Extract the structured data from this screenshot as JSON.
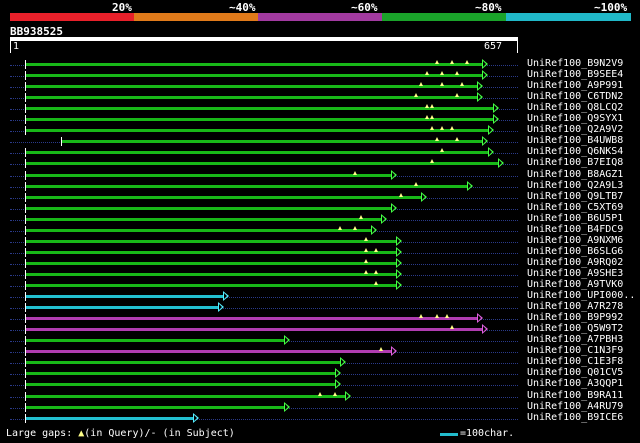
{
  "legend": {
    "labels": [
      "20%",
      "~40%",
      "~60%",
      "~80%",
      "~100%"
    ],
    "colors": [
      "#e8202a",
      "#e07a1a",
      "#a23aa0",
      "#1aa32a",
      "#20b8c8"
    ]
  },
  "query": {
    "id": "BB938525",
    "start": "1",
    "end": "657"
  },
  "hits": [
    {
      "id": "UniRef100_B9N2V9",
      "color": "green",
      "start": 0.03,
      "end": 0.93,
      "gaps": [
        0.84,
        0.87,
        0.9
      ]
    },
    {
      "id": "UniRef100_B9SEE4",
      "color": "green",
      "start": 0.03,
      "end": 0.93,
      "gaps": [
        0.82,
        0.85,
        0.88
      ]
    },
    {
      "id": "UniRef100_A9P991",
      "color": "green",
      "start": 0.03,
      "end": 0.92,
      "gaps": [
        0.81,
        0.85,
        0.89
      ]
    },
    {
      "id": "UniRef100_C6TDN2",
      "color": "green",
      "start": 0.03,
      "end": 0.92,
      "gaps": [
        0.8,
        0.88
      ]
    },
    {
      "id": "UniRef100_Q8LCQ2",
      "color": "green",
      "start": 0.03,
      "end": 0.95,
      "gaps": [
        0.82,
        0.83
      ]
    },
    {
      "id": "UniRef100_Q9SYX1",
      "color": "green",
      "start": 0.03,
      "end": 0.95,
      "gaps": [
        0.82,
        0.83
      ]
    },
    {
      "id": "UniRef100_Q2A9V2",
      "color": "green",
      "start": 0.03,
      "end": 0.94,
      "gaps": [
        0.83,
        0.85,
        0.87
      ]
    },
    {
      "id": "UniRef100_B4UWB8",
      "color": "green",
      "start": 0.1,
      "end": 0.93,
      "gaps": [
        0.84,
        0.88
      ]
    },
    {
      "id": "UniRef100_Q6NKS4",
      "color": "green",
      "start": 0.03,
      "end": 0.94,
      "gaps": [
        0.85
      ]
    },
    {
      "id": "UniRef100_B7EIQ8",
      "color": "green",
      "start": 0.03,
      "end": 0.96,
      "gaps": [
        0.83
      ]
    },
    {
      "id": "UniRef100_B8AGZ1",
      "color": "green",
      "start": 0.03,
      "end": 0.75,
      "gaps": [
        0.68
      ]
    },
    {
      "id": "UniRef100_Q2A9L3",
      "color": "green",
      "start": 0.03,
      "end": 0.9,
      "gaps": [
        0.8
      ]
    },
    {
      "id": "UniRef100_Q9LTB7",
      "color": "green",
      "start": 0.03,
      "end": 0.81,
      "gaps": [
        0.77
      ]
    },
    {
      "id": "UniRef100_C5XT69",
      "color": "green",
      "start": 0.03,
      "end": 0.75,
      "gaps": []
    },
    {
      "id": "UniRef100_B6U5P1",
      "color": "green",
      "start": 0.03,
      "end": 0.73,
      "gaps": [
        0.69
      ]
    },
    {
      "id": "UniRef100_B4FDC9",
      "color": "green",
      "start": 0.03,
      "end": 0.71,
      "gaps": [
        0.65,
        0.68
      ]
    },
    {
      "id": "UniRef100_A9NXM6",
      "color": "green",
      "start": 0.03,
      "end": 0.76,
      "gaps": [
        0.7
      ]
    },
    {
      "id": "UniRef100_B6SLG6",
      "color": "green",
      "start": 0.03,
      "end": 0.76,
      "gaps": [
        0.7,
        0.72
      ]
    },
    {
      "id": "UniRef100_A9RQ02",
      "color": "green",
      "start": 0.03,
      "end": 0.76,
      "gaps": [
        0.7
      ]
    },
    {
      "id": "UniRef100_A9SHE3",
      "color": "green",
      "start": 0.03,
      "end": 0.76,
      "gaps": [
        0.7,
        0.72
      ]
    },
    {
      "id": "UniRef100_A9TVK0",
      "color": "green",
      "start": 0.03,
      "end": 0.76,
      "gaps": [
        0.72
      ]
    },
    {
      "id": "UniRef100_UPI000..",
      "color": "cyan",
      "start": 0.03,
      "end": 0.42,
      "gaps": []
    },
    {
      "id": "UniRef100_A7R278",
      "color": "cyan",
      "start": 0.03,
      "end": 0.41,
      "gaps": []
    },
    {
      "id": "UniRef100_B9P992",
      "color": "purple",
      "start": 0.03,
      "end": 0.92,
      "gaps": [
        0.81,
        0.84,
        0.86
      ]
    },
    {
      "id": "UniRef100_Q5W9T2",
      "color": "purple",
      "start": 0.03,
      "end": 0.93,
      "gaps": [
        0.87
      ]
    },
    {
      "id": "UniRef100_A7PBH3",
      "color": "green",
      "start": 0.03,
      "end": 0.54,
      "gaps": []
    },
    {
      "id": "UniRef100_C1N3F9",
      "color": "purple",
      "start": 0.03,
      "end": 0.75,
      "gaps": [
        0.73
      ]
    },
    {
      "id": "UniRef100_C1E3F8",
      "color": "green",
      "start": 0.03,
      "end": 0.65,
      "gaps": []
    },
    {
      "id": "UniRef100_Q01CV5",
      "color": "green",
      "start": 0.03,
      "end": 0.64,
      "gaps": []
    },
    {
      "id": "UniRef100_A3QQP1",
      "color": "green",
      "start": 0.03,
      "end": 0.64,
      "gaps": []
    },
    {
      "id": "UniRef100_B9RA11",
      "color": "green",
      "start": 0.03,
      "end": 0.66,
      "gaps": [
        0.61,
        0.64
      ]
    },
    {
      "id": "UniRef100_A4RU79",
      "color": "green",
      "start": 0.03,
      "end": 0.54,
      "gaps": []
    },
    {
      "id": "UniRef100_B9ICE6",
      "color": "cyan",
      "start": 0.03,
      "end": 0.36,
      "gaps": []
    }
  ],
  "colors": {
    "green": "#18b818",
    "cyan": "#22c0d0",
    "purple": "#b03cb0",
    "arrow_green": "#44ff44",
    "arrow_cyan": "#55eeff",
    "arrow_purple": "#e060e0"
  },
  "footer": {
    "gaps_prefix": "Large gaps: ",
    "gap_glyph": "▲",
    "gaps_suffix": "(in Query)/- (in Subject)",
    "scale_label": "=100char."
  }
}
